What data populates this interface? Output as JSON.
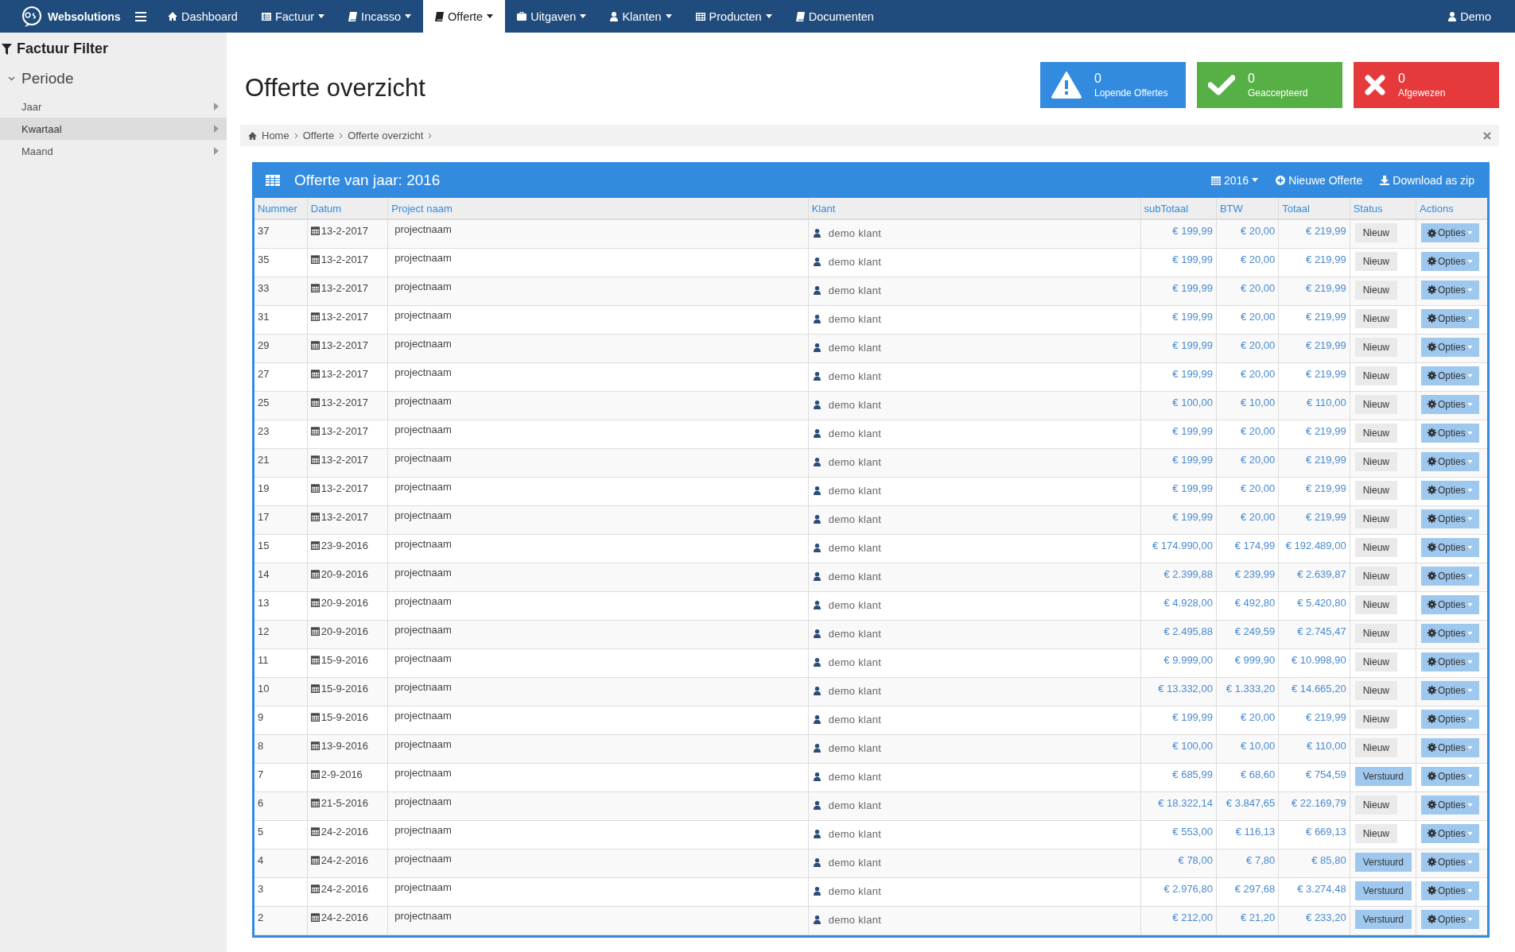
{
  "navbar": {
    "brand": "Websolutions",
    "items": [
      {
        "label": "Dashboard",
        "caret": false,
        "selected": false
      },
      {
        "label": "Factuur",
        "caret": true,
        "selected": false
      },
      {
        "label": "Incasso",
        "caret": true,
        "selected": false
      },
      {
        "label": "Offerte",
        "caret": true,
        "selected": true
      },
      {
        "label": "Uitgaven",
        "caret": true,
        "selected": false
      },
      {
        "label": "Klanten",
        "caret": true,
        "selected": false
      },
      {
        "label": "Producten",
        "caret": true,
        "selected": false
      },
      {
        "label": "Documenten",
        "caret": false,
        "selected": false
      }
    ],
    "user": "Demo"
  },
  "sidebar": {
    "title": "Factuur Filter",
    "section": "Periode",
    "items": [
      {
        "label": "Jaar",
        "selected": false
      },
      {
        "label": "Kwartaal",
        "selected": true
      },
      {
        "label": "Maand",
        "selected": false
      }
    ]
  },
  "page_title": "Offerte overzicht",
  "stats": [
    {
      "kind": "warning",
      "count": "0",
      "label": "Lopende Offertes"
    },
    {
      "kind": "success",
      "count": "0",
      "label": "Geaccepteerd"
    },
    {
      "kind": "danger",
      "count": "0",
      "label": "Afgewezen"
    }
  ],
  "breadcrumb": [
    "Home",
    "Offerte",
    "Offerte overzicht"
  ],
  "panel": {
    "title": "Offerte van jaar: 2016",
    "year": "2016",
    "new_button": "Nieuwe Offerte",
    "download_button": "Download as zip"
  },
  "table": {
    "columns": [
      "Nummer",
      "Datum",
      "Project naam",
      "Klant",
      "subTotaal",
      "BTW",
      "Totaal",
      "Status",
      "Actions"
    ],
    "rows": [
      {
        "nummer": "37",
        "datum": "13-2-2017",
        "project": "projectnaam",
        "klant": "demo klant",
        "subtotaal": "€ 199,99",
        "btw": "€ 20,00",
        "totaal": "€ 219,99",
        "status": "Nieuw",
        "kind": "new",
        "action": "Opties"
      },
      {
        "nummer": "35",
        "datum": "13-2-2017",
        "project": "projectnaam",
        "klant": "demo klant",
        "subtotaal": "€ 199,99",
        "btw": "€ 20,00",
        "totaal": "€ 219,99",
        "status": "Nieuw",
        "kind": "new",
        "action": "Opties"
      },
      {
        "nummer": "33",
        "datum": "13-2-2017",
        "project": "projectnaam",
        "klant": "demo klant",
        "subtotaal": "€ 199,99",
        "btw": "€ 20,00",
        "totaal": "€ 219,99",
        "status": "Nieuw",
        "kind": "new",
        "action": "Opties"
      },
      {
        "nummer": "31",
        "datum": "13-2-2017",
        "project": "projectnaam",
        "klant": "demo klant",
        "subtotaal": "€ 199,99",
        "btw": "€ 20,00",
        "totaal": "€ 219,99",
        "status": "Nieuw",
        "kind": "new",
        "action": "Opties"
      },
      {
        "nummer": "29",
        "datum": "13-2-2017",
        "project": "projectnaam",
        "klant": "demo klant",
        "subtotaal": "€ 199,99",
        "btw": "€ 20,00",
        "totaal": "€ 219,99",
        "status": "Nieuw",
        "kind": "new",
        "action": "Opties"
      },
      {
        "nummer": "27",
        "datum": "13-2-2017",
        "project": "projectnaam",
        "klant": "demo klant",
        "subtotaal": "€ 199,99",
        "btw": "€ 20,00",
        "totaal": "€ 219,99",
        "status": "Nieuw",
        "kind": "new",
        "action": "Opties"
      },
      {
        "nummer": "25",
        "datum": "13-2-2017",
        "project": "projectnaam",
        "klant": "demo klant",
        "subtotaal": "€ 100,00",
        "btw": "€ 10,00",
        "totaal": "€ 110,00",
        "status": "Nieuw",
        "kind": "new",
        "action": "Opties"
      },
      {
        "nummer": "23",
        "datum": "13-2-2017",
        "project": "projectnaam",
        "klant": "demo klant",
        "subtotaal": "€ 199,99",
        "btw": "€ 20,00",
        "totaal": "€ 219,99",
        "status": "Nieuw",
        "kind": "new",
        "action": "Opties"
      },
      {
        "nummer": "21",
        "datum": "13-2-2017",
        "project": "projectnaam",
        "klant": "demo klant",
        "subtotaal": "€ 199,99",
        "btw": "€ 20,00",
        "totaal": "€ 219,99",
        "status": "Nieuw",
        "kind": "new",
        "action": "Opties"
      },
      {
        "nummer": "19",
        "datum": "13-2-2017",
        "project": "projectnaam",
        "klant": "demo klant",
        "subtotaal": "€ 199,99",
        "btw": "€ 20,00",
        "totaal": "€ 219,99",
        "status": "Nieuw",
        "kind": "new",
        "action": "Opties"
      },
      {
        "nummer": "17",
        "datum": "13-2-2017",
        "project": "projectnaam",
        "klant": "demo klant",
        "subtotaal": "€ 199,99",
        "btw": "€ 20,00",
        "totaal": "€ 219,99",
        "status": "Nieuw",
        "kind": "new",
        "action": "Opties"
      },
      {
        "nummer": "15",
        "datum": "23-9-2016",
        "project": "projectnaam",
        "klant": "demo klant",
        "subtotaal": "€ 174.990,00",
        "btw": "€ 174,99",
        "totaal": "€ 192.489,00",
        "status": "Nieuw",
        "kind": "new",
        "action": "Opties"
      },
      {
        "nummer": "14",
        "datum": "20-9-2016",
        "project": "projectnaam",
        "klant": "demo klant",
        "subtotaal": "€ 2.399,88",
        "btw": "€ 239,99",
        "totaal": "€ 2.639,87",
        "status": "Nieuw",
        "kind": "new",
        "action": "Opties"
      },
      {
        "nummer": "13",
        "datum": "20-9-2016",
        "project": "projectnaam",
        "klant": "demo klant",
        "subtotaal": "€ 4.928,00",
        "btw": "€ 492,80",
        "totaal": "€ 5.420,80",
        "status": "Nieuw",
        "kind": "new",
        "action": "Opties"
      },
      {
        "nummer": "12",
        "datum": "20-9-2016",
        "project": "projectnaam",
        "klant": "demo klant",
        "subtotaal": "€ 2.495,88",
        "btw": "€ 249,59",
        "totaal": "€ 2.745,47",
        "status": "Nieuw",
        "kind": "new",
        "action": "Opties"
      },
      {
        "nummer": "11",
        "datum": "15-9-2016",
        "project": "projectnaam",
        "klant": "demo klant",
        "subtotaal": "€ 9.999,00",
        "btw": "€ 999,90",
        "totaal": "€ 10.998,90",
        "status": "Nieuw",
        "kind": "new",
        "action": "Opties"
      },
      {
        "nummer": "10",
        "datum": "15-9-2016",
        "project": "projectnaam",
        "klant": "demo klant",
        "subtotaal": "€ 13.332,00",
        "btw": "€ 1.333,20",
        "totaal": "€ 14.665,20",
        "status": "Nieuw",
        "kind": "new",
        "action": "Opties"
      },
      {
        "nummer": "9",
        "datum": "15-9-2016",
        "project": "projectnaam",
        "klant": "demo klant",
        "subtotaal": "€ 199,99",
        "btw": "€ 20,00",
        "totaal": "€ 219,99",
        "status": "Nieuw",
        "kind": "new",
        "action": "Opties"
      },
      {
        "nummer": "8",
        "datum": "13-9-2016",
        "project": "projectnaam",
        "klant": "demo klant",
        "subtotaal": "€ 100,00",
        "btw": "€ 10,00",
        "totaal": "€ 110,00",
        "status": "Nieuw",
        "kind": "new",
        "action": "Opties"
      },
      {
        "nummer": "7",
        "datum": "2-9-2016",
        "project": "projectnaam",
        "klant": "demo klant",
        "subtotaal": "€ 685,99",
        "btw": "€ 68,60",
        "totaal": "€ 754,59",
        "status": "Verstuurd",
        "kind": "sent",
        "action": "Opties"
      },
      {
        "nummer": "6",
        "datum": "21-5-2016",
        "project": "projectnaam",
        "klant": "demo klant",
        "subtotaal": "€ 18.322,14",
        "btw": "€ 3.847,65",
        "totaal": "€ 22.169,79",
        "status": "Nieuw",
        "kind": "new",
        "action": "Opties"
      },
      {
        "nummer": "5",
        "datum": "24-2-2016",
        "project": "projectnaam",
        "klant": "demo klant",
        "subtotaal": "€ 553,00",
        "btw": "€ 116,13",
        "totaal": "€ 669,13",
        "status": "Nieuw",
        "kind": "new",
        "action": "Opties"
      },
      {
        "nummer": "4",
        "datum": "24-2-2016",
        "project": "projectnaam",
        "klant": "demo klant",
        "subtotaal": "€ 78,00",
        "btw": "€ 7,80",
        "totaal": "€ 85,80",
        "status": "Verstuurd",
        "kind": "sent",
        "action": "Opties"
      },
      {
        "nummer": "3",
        "datum": "24-2-2016",
        "project": "projectnaam",
        "klant": "demo klant",
        "subtotaal": "€ 2.976,80",
        "btw": "€ 297,68",
        "totaal": "€ 3.274,48",
        "status": "Verstuurd",
        "kind": "sent",
        "action": "Opties"
      },
      {
        "nummer": "2",
        "datum": "24-2-2016",
        "project": "projectnaam",
        "klant": "demo klant",
        "subtotaal": "€ 212,00",
        "btw": "€ 21,20",
        "totaal": "€ 233,20",
        "status": "Verstuurd",
        "kind": "sent",
        "action": "Opties"
      }
    ]
  }
}
